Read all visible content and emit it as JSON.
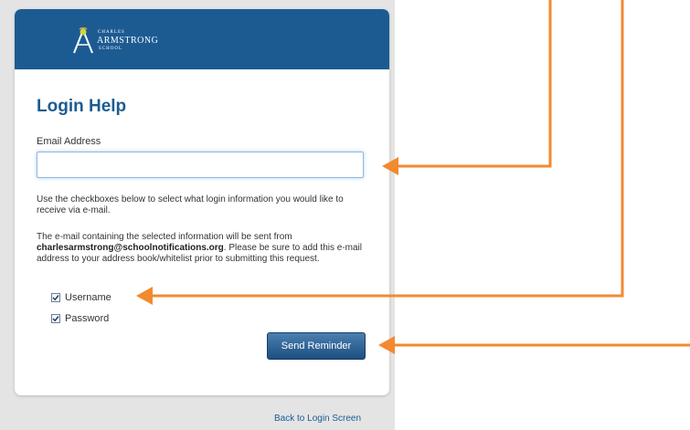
{
  "logo": {
    "top_text": "CHARLES",
    "main_text": "ARMSTRONG",
    "bottom_text": "SCHOOL"
  },
  "form": {
    "title": "Login Help",
    "email_label": "Email Address",
    "email_value": "",
    "instructions": "Use the checkboxes below to select what login information you would like to receive via e-mail.",
    "notice_before": "The e-mail containing the selected information will be sent from ",
    "sender_email": "charlesarmstrong@schoolnotifications.org",
    "notice_after": ". Please be sure to add this e-mail address to your address book/whitelist prior to submitting this request.",
    "options": [
      {
        "label": "Username",
        "checked": true
      },
      {
        "label": "Password",
        "checked": true
      }
    ],
    "submit_label": "Send Reminder",
    "back_link": "Back to Login Screen"
  },
  "colors": {
    "brand_blue": "#1c5b92",
    "arrow_orange": "#f28a30",
    "panel_gray": "#e4e4e4"
  }
}
